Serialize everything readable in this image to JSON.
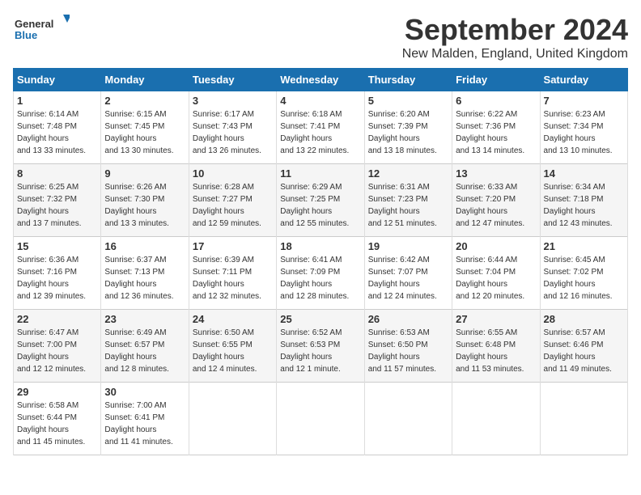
{
  "logo": {
    "name": "General",
    "name2": "Blue"
  },
  "title": "September 2024",
  "location": "New Malden, England, United Kingdom",
  "days_of_week": [
    "Sunday",
    "Monday",
    "Tuesday",
    "Wednesday",
    "Thursday",
    "Friday",
    "Saturday"
  ],
  "weeks": [
    [
      {
        "day": "1",
        "sunrise": "6:14 AM",
        "sunset": "7:48 PM",
        "daylight": "13 hours and 33 minutes."
      },
      {
        "day": "2",
        "sunrise": "6:15 AM",
        "sunset": "7:45 PM",
        "daylight": "13 hours and 30 minutes."
      },
      {
        "day": "3",
        "sunrise": "6:17 AM",
        "sunset": "7:43 PM",
        "daylight": "13 hours and 26 minutes."
      },
      {
        "day": "4",
        "sunrise": "6:18 AM",
        "sunset": "7:41 PM",
        "daylight": "13 hours and 22 minutes."
      },
      {
        "day": "5",
        "sunrise": "6:20 AM",
        "sunset": "7:39 PM",
        "daylight": "13 hours and 18 minutes."
      },
      {
        "day": "6",
        "sunrise": "6:22 AM",
        "sunset": "7:36 PM",
        "daylight": "13 hours and 14 minutes."
      },
      {
        "day": "7",
        "sunrise": "6:23 AM",
        "sunset": "7:34 PM",
        "daylight": "13 hours and 10 minutes."
      }
    ],
    [
      {
        "day": "8",
        "sunrise": "6:25 AM",
        "sunset": "7:32 PM",
        "daylight": "13 hours and 7 minutes."
      },
      {
        "day": "9",
        "sunrise": "6:26 AM",
        "sunset": "7:30 PM",
        "daylight": "13 hours and 3 minutes."
      },
      {
        "day": "10",
        "sunrise": "6:28 AM",
        "sunset": "7:27 PM",
        "daylight": "12 hours and 59 minutes."
      },
      {
        "day": "11",
        "sunrise": "6:29 AM",
        "sunset": "7:25 PM",
        "daylight": "12 hours and 55 minutes."
      },
      {
        "day": "12",
        "sunrise": "6:31 AM",
        "sunset": "7:23 PM",
        "daylight": "12 hours and 51 minutes."
      },
      {
        "day": "13",
        "sunrise": "6:33 AM",
        "sunset": "7:20 PM",
        "daylight": "12 hours and 47 minutes."
      },
      {
        "day": "14",
        "sunrise": "6:34 AM",
        "sunset": "7:18 PM",
        "daylight": "12 hours and 43 minutes."
      }
    ],
    [
      {
        "day": "15",
        "sunrise": "6:36 AM",
        "sunset": "7:16 PM",
        "daylight": "12 hours and 39 minutes."
      },
      {
        "day": "16",
        "sunrise": "6:37 AM",
        "sunset": "7:13 PM",
        "daylight": "12 hours and 36 minutes."
      },
      {
        "day": "17",
        "sunrise": "6:39 AM",
        "sunset": "7:11 PM",
        "daylight": "12 hours and 32 minutes."
      },
      {
        "day": "18",
        "sunrise": "6:41 AM",
        "sunset": "7:09 PM",
        "daylight": "12 hours and 28 minutes."
      },
      {
        "day": "19",
        "sunrise": "6:42 AM",
        "sunset": "7:07 PM",
        "daylight": "12 hours and 24 minutes."
      },
      {
        "day": "20",
        "sunrise": "6:44 AM",
        "sunset": "7:04 PM",
        "daylight": "12 hours and 20 minutes."
      },
      {
        "day": "21",
        "sunrise": "6:45 AM",
        "sunset": "7:02 PM",
        "daylight": "12 hours and 16 minutes."
      }
    ],
    [
      {
        "day": "22",
        "sunrise": "6:47 AM",
        "sunset": "7:00 PM",
        "daylight": "12 hours and 12 minutes."
      },
      {
        "day": "23",
        "sunrise": "6:49 AM",
        "sunset": "6:57 PM",
        "daylight": "12 hours and 8 minutes."
      },
      {
        "day": "24",
        "sunrise": "6:50 AM",
        "sunset": "6:55 PM",
        "daylight": "12 hours and 4 minutes."
      },
      {
        "day": "25",
        "sunrise": "6:52 AM",
        "sunset": "6:53 PM",
        "daylight": "12 hours and 1 minute."
      },
      {
        "day": "26",
        "sunrise": "6:53 AM",
        "sunset": "6:50 PM",
        "daylight": "11 hours and 57 minutes."
      },
      {
        "day": "27",
        "sunrise": "6:55 AM",
        "sunset": "6:48 PM",
        "daylight": "11 hours and 53 minutes."
      },
      {
        "day": "28",
        "sunrise": "6:57 AM",
        "sunset": "6:46 PM",
        "daylight": "11 hours and 49 minutes."
      }
    ],
    [
      {
        "day": "29",
        "sunrise": "6:58 AM",
        "sunset": "6:44 PM",
        "daylight": "11 hours and 45 minutes."
      },
      {
        "day": "30",
        "sunrise": "7:00 AM",
        "sunset": "6:41 PM",
        "daylight": "11 hours and 41 minutes."
      },
      null,
      null,
      null,
      null,
      null
    ]
  ]
}
